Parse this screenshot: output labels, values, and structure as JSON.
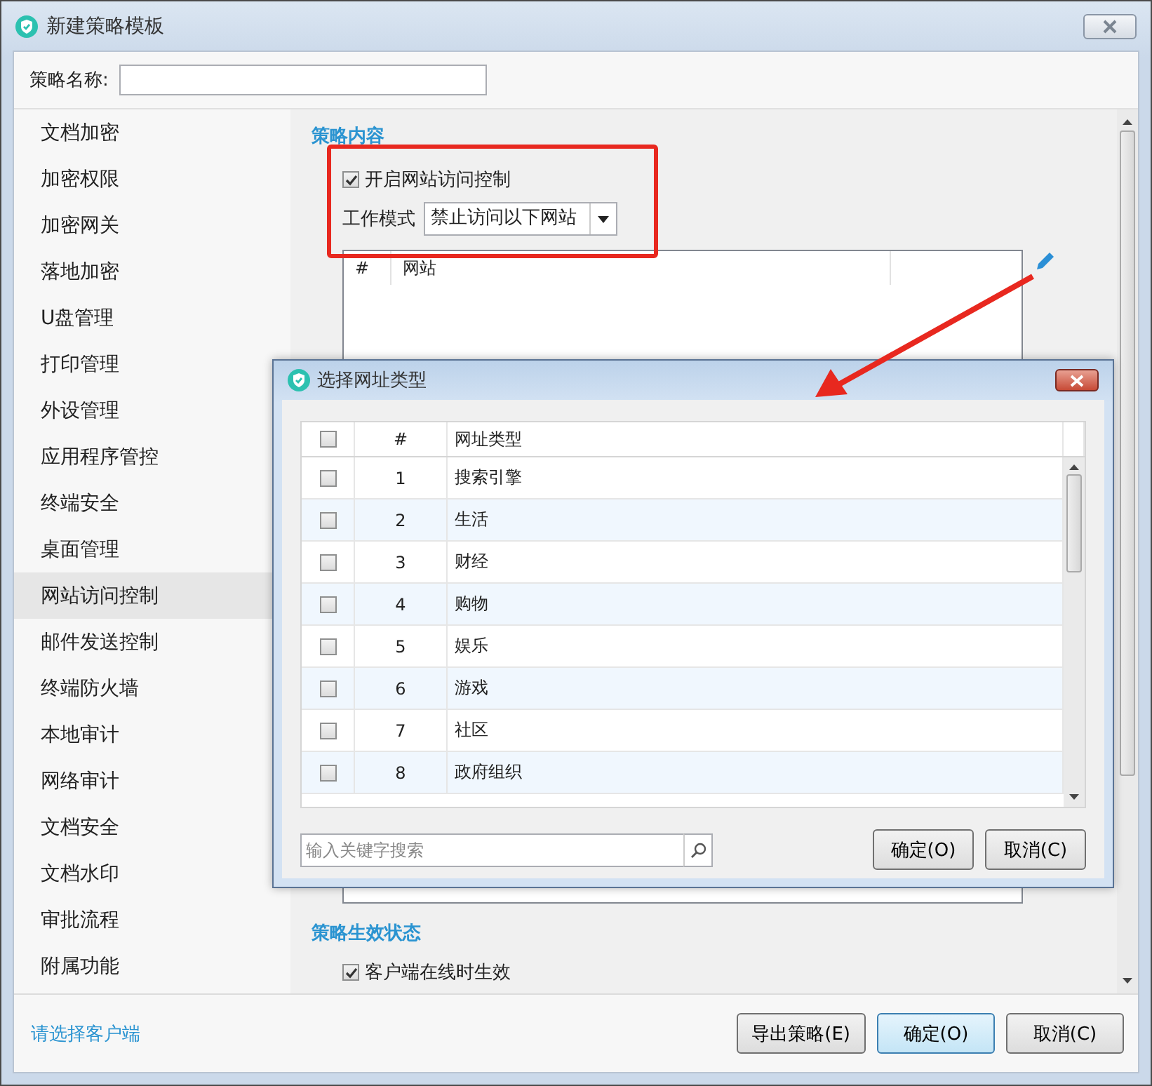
{
  "window": {
    "title": "新建策略模板"
  },
  "name_field": {
    "label": "策略名称:"
  },
  "sidebar": {
    "items": [
      {
        "label": "文档加密",
        "selected": false
      },
      {
        "label": "加密权限",
        "selected": false
      },
      {
        "label": "加密网关",
        "selected": false
      },
      {
        "label": "落地加密",
        "selected": false
      },
      {
        "label": "U盘管理",
        "selected": false
      },
      {
        "label": "打印管理",
        "selected": false
      },
      {
        "label": "外设管理",
        "selected": false
      },
      {
        "label": "应用程序管控",
        "selected": false
      },
      {
        "label": "终端安全",
        "selected": false
      },
      {
        "label": "桌面管理",
        "selected": false
      },
      {
        "label": "网站访问控制",
        "selected": true
      },
      {
        "label": "邮件发送控制",
        "selected": false
      },
      {
        "label": "终端防火墙",
        "selected": false
      },
      {
        "label": "本地审计",
        "selected": false
      },
      {
        "label": "网络审计",
        "selected": false
      },
      {
        "label": "文档安全",
        "selected": false
      },
      {
        "label": "文档水印",
        "selected": false
      },
      {
        "label": "审批流程",
        "selected": false
      },
      {
        "label": "附属功能",
        "selected": false
      }
    ]
  },
  "content": {
    "section_title": "策略内容",
    "enable": {
      "label": "开启网站访问控制",
      "checked": true
    },
    "mode": {
      "label": "工作模式",
      "value": "禁止访问以下网站"
    },
    "site_table": {
      "columns": [
        "#",
        "网站"
      ]
    },
    "status_section": {
      "title": "策略生效状态",
      "option": {
        "label": "客户端在线时生效",
        "checked": true
      }
    }
  },
  "footer": {
    "link": "请选择客户端",
    "buttons": [
      {
        "label": "导出策略(E)",
        "default": false
      },
      {
        "label": "确定(O)",
        "default": true
      },
      {
        "label": "取消(C)",
        "default": false
      }
    ]
  },
  "dialog": {
    "title": "选择网址类型",
    "columns": [
      "#",
      "网址类型"
    ],
    "header_checked": false,
    "rows": [
      {
        "index": "1",
        "type": "搜索引擎",
        "checked": false
      },
      {
        "index": "2",
        "type": "生活",
        "checked": false
      },
      {
        "index": "3",
        "type": "财经",
        "checked": false
      },
      {
        "index": "4",
        "type": "购物",
        "checked": false
      },
      {
        "index": "5",
        "type": "娱乐",
        "checked": false
      },
      {
        "index": "6",
        "type": "游戏",
        "checked": false
      },
      {
        "index": "7",
        "type": "社区",
        "checked": false
      },
      {
        "index": "8",
        "type": "政府组织",
        "checked": false
      }
    ],
    "search": {
      "placeholder": "输入关键字搜索"
    },
    "buttons": [
      "确定(O)",
      "取消(C)"
    ]
  }
}
